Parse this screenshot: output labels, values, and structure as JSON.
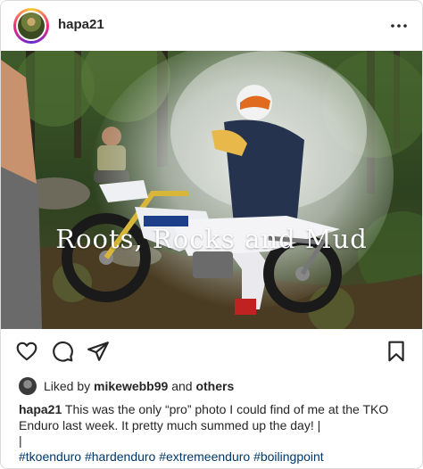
{
  "post": {
    "username": "hapa21",
    "media": {
      "overlay_title": "Roots, Rocks and Mud"
    },
    "likes": {
      "prefix": "Liked by",
      "liker": "mikewebb99",
      "connector": "and",
      "others": "others"
    },
    "caption": {
      "username": "hapa21",
      "text": "This was the only “pro” photo I could find of me at the TKO Enduro last week. It pretty much summed up the day! |",
      "line2": "|",
      "hashtags": "#tkoenduro #hardenduro #extremeenduro #boilingpoint"
    },
    "icons": {
      "more": "more-horizontal-icon",
      "like": "heart-icon",
      "comment": "comment-icon",
      "share": "paper-plane-icon",
      "save": "bookmark-icon"
    },
    "colors": {
      "text": "#262626",
      "hashtag": "#00376b",
      "border": "#dbdbdb"
    }
  }
}
